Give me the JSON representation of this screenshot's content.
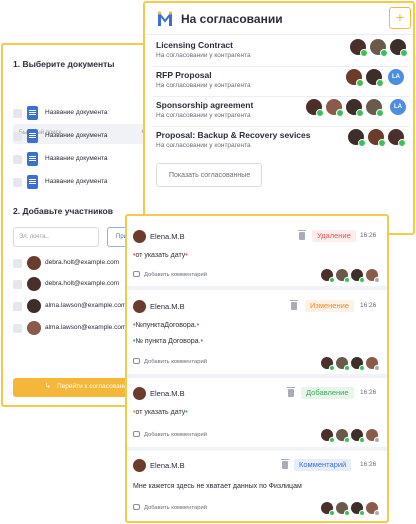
{
  "left_panel": {
    "step1_title": "1. Выберите документы",
    "search_placeholder": "Быстрый поиск..",
    "search_icon": "search-icon",
    "documents": [
      {
        "label": "Название документа"
      },
      {
        "label": "Название документа"
      },
      {
        "label": "Название документа"
      },
      {
        "label": "Название документа"
      }
    ],
    "step2_title": "2. Добавьте участников",
    "email_placeholder": "Эл. почта..",
    "add_button_label": "Пригласить",
    "participants": [
      {
        "email": "debra.holt@example.com",
        "avatar_color": "#6b3b2c"
      },
      {
        "email": "debra.holt@example.com",
        "avatar_color": "#4a2f2a"
      },
      {
        "email": "alma.lawson@example.com",
        "avatar_color": "#3d2e2a"
      },
      {
        "email": "alma.lawson@example.com",
        "avatar_color": "#8a5a4a"
      }
    ],
    "go_button_label": "Перейти к согласованию"
  },
  "approval_card": {
    "title": "На согласовании",
    "logo_icon": "m-logo-icon",
    "add_icon": "plus-icon",
    "items": [
      {
        "name": "Licensing Contract",
        "status": "На согласовании у контрагента"
      },
      {
        "name": "RFP Proposal",
        "status": "На согласовании у контрагента"
      },
      {
        "name": "Sponsorship agreement",
        "status": "На согласовании у контрагента"
      },
      {
        "name": "Proposal: Backup & Recovery sevices",
        "status": "На согласовании у контрагента"
      }
    ],
    "la_initials": "LA",
    "show_button_label": "Показать согласованные"
  },
  "comments": [
    {
      "author": "Elena.M.B",
      "tag": "Удаление",
      "time": "16:26",
      "lines": [
        {
          "before": "•",
          "text": "от указать дату",
          "after": "•"
        }
      ],
      "add_label": "Добавить комментарий"
    },
    {
      "author": "Elena.M.B",
      "tag": "Изменение",
      "time": "16:26",
      "lines": [
        {
          "before": "•",
          "text": "№пунктаДоговора.",
          "after": "•"
        },
        {
          "before": "•",
          "text": "№ пункта Договора.",
          "after": "•"
        }
      ],
      "add_label": "Добавить комментарий"
    },
    {
      "author": "Elena.M.B",
      "tag": "Добавление",
      "time": "16:26",
      "lines": [
        {
          "before": "•",
          "text": "от указать дату",
          "after": "•"
        }
      ],
      "add_label": "Добавить комментарий"
    },
    {
      "author": "Elena.M.B",
      "tag": "Комментарий",
      "time": "16:26",
      "lines": [
        {
          "before": "",
          "text": "Мне кажется здесь не хватает данных по Физлицам",
          "after": ""
        }
      ],
      "add_label": "Добавить комментарий"
    }
  ],
  "colors": {
    "accent": "#f4b73a",
    "border": "#f6c94a",
    "primary_blue": "#3b6fd4",
    "delete_red": "#e55a5a",
    "change_orange": "#f08c2a",
    "add_green": "#3fa55a"
  }
}
